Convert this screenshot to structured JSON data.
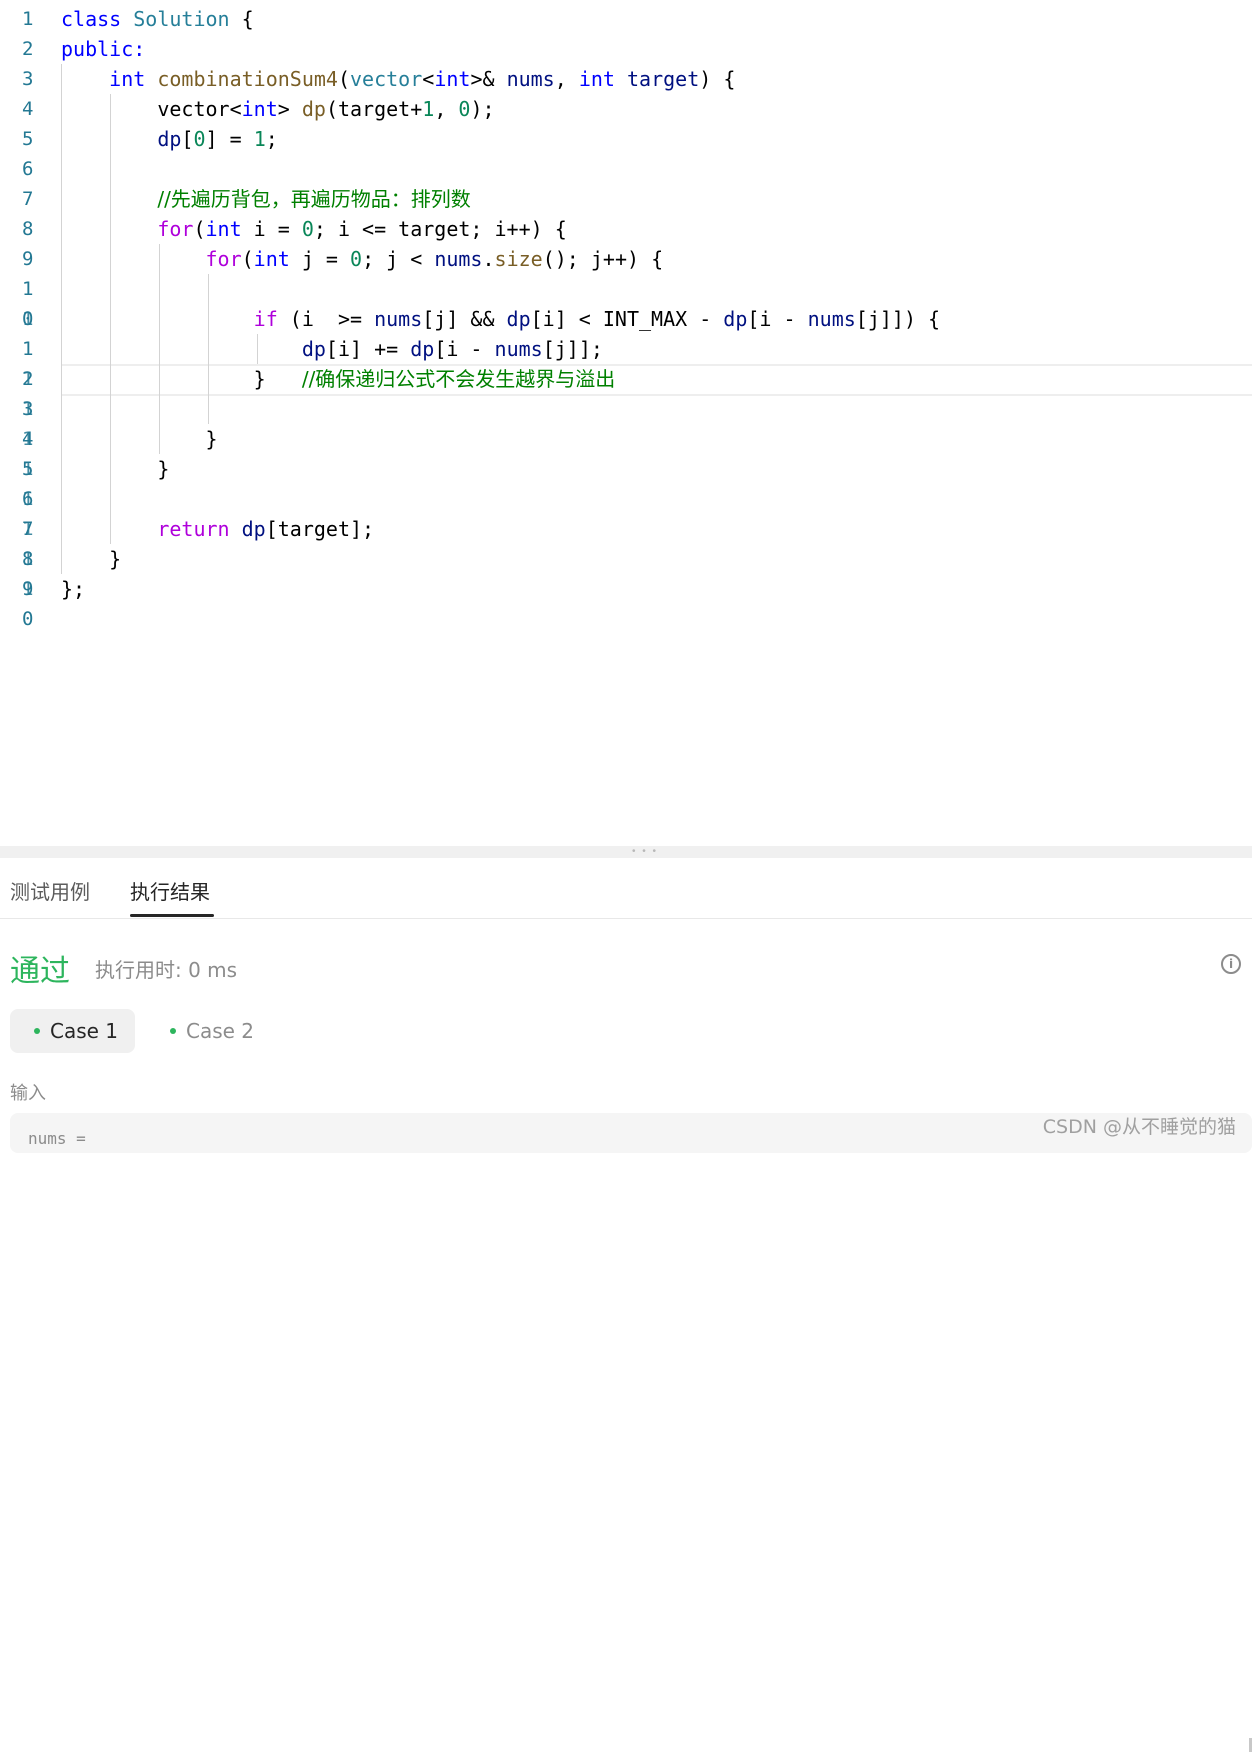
{
  "editor": {
    "line_numbers": [
      "1",
      "2",
      "3",
      "4",
      "5",
      "6",
      "7",
      "8",
      "9",
      "1",
      "0",
      "1",
      "2",
      "3",
      "4",
      "5",
      "6",
      "7",
      "8",
      "9",
      "0"
    ],
    "overlap_numbers": [
      "",
      "",
      "",
      "",
      "",
      "",
      "",
      "",
      "",
      "",
      "1",
      "",
      "1",
      "1",
      "1",
      "1",
      "1",
      "1",
      "1",
      "1",
      ""
    ],
    "lines": [
      [
        {
          "t": "class ",
          "c": "kw"
        },
        {
          "t": "Solution",
          "c": "ty"
        },
        {
          "t": " {",
          "c": ""
        }
      ],
      [
        {
          "t": "public:",
          "c": "kw"
        }
      ],
      [
        {
          "t": "    ",
          "c": ""
        },
        {
          "t": "int",
          "c": "kw"
        },
        {
          "t": " ",
          "c": ""
        },
        {
          "t": "combinationSum4",
          "c": "fn"
        },
        {
          "t": "(",
          "c": ""
        },
        {
          "t": "vector",
          "c": "ty"
        },
        {
          "t": "<",
          "c": ""
        },
        {
          "t": "int",
          "c": "kw"
        },
        {
          "t": ">& ",
          "c": ""
        },
        {
          "t": "nums",
          "c": "var"
        },
        {
          "t": ", ",
          "c": ""
        },
        {
          "t": "int",
          "c": "kw"
        },
        {
          "t": " ",
          "c": ""
        },
        {
          "t": "target",
          "c": "var"
        },
        {
          "t": ") {",
          "c": ""
        }
      ],
      [
        {
          "t": "        vector<",
          "c": ""
        },
        {
          "t": "int",
          "c": "kw"
        },
        {
          "t": "> ",
          "c": ""
        },
        {
          "t": "dp",
          "c": "fn"
        },
        {
          "t": "(target+",
          "c": ""
        },
        {
          "t": "1",
          "c": "nm"
        },
        {
          "t": ", ",
          "c": ""
        },
        {
          "t": "0",
          "c": "nm"
        },
        {
          "t": ");",
          "c": ""
        }
      ],
      [
        {
          "t": "        ",
          "c": ""
        },
        {
          "t": "dp",
          "c": "var"
        },
        {
          "t": "[",
          "c": ""
        },
        {
          "t": "0",
          "c": "nm"
        },
        {
          "t": "] = ",
          "c": ""
        },
        {
          "t": "1",
          "c": "nm"
        },
        {
          "t": ";",
          "c": ""
        }
      ],
      [],
      [
        {
          "t": "        ",
          "c": ""
        },
        {
          "t": "//先遍历背包，再遍历物品：排列数",
          "c": "cm"
        }
      ],
      [
        {
          "t": "        ",
          "c": ""
        },
        {
          "t": "for",
          "c": "kw2"
        },
        {
          "t": "(",
          "c": ""
        },
        {
          "t": "int",
          "c": "kw"
        },
        {
          "t": " i = ",
          "c": ""
        },
        {
          "t": "0",
          "c": "nm"
        },
        {
          "t": "; i <= target; i++) {",
          "c": ""
        }
      ],
      [
        {
          "t": "            ",
          "c": ""
        },
        {
          "t": "for",
          "c": "kw2"
        },
        {
          "t": "(",
          "c": ""
        },
        {
          "t": "int",
          "c": "kw"
        },
        {
          "t": " j = ",
          "c": ""
        },
        {
          "t": "0",
          "c": "nm"
        },
        {
          "t": "; j < ",
          "c": ""
        },
        {
          "t": "nums",
          "c": "var"
        },
        {
          "t": ".",
          "c": ""
        },
        {
          "t": "size",
          "c": "fn"
        },
        {
          "t": "(); j++) {",
          "c": ""
        }
      ],
      [],
      [
        {
          "t": "                ",
          "c": ""
        },
        {
          "t": "if",
          "c": "kw2"
        },
        {
          "t": " (i  >= ",
          "c": ""
        },
        {
          "t": "nums",
          "c": "var"
        },
        {
          "t": "[j] && ",
          "c": ""
        },
        {
          "t": "dp",
          "c": "var"
        },
        {
          "t": "[i] < INT_MAX - ",
          "c": ""
        },
        {
          "t": "dp",
          "c": "var"
        },
        {
          "t": "[i - ",
          "c": ""
        },
        {
          "t": "nums",
          "c": "var"
        },
        {
          "t": "[j]]) {",
          "c": ""
        }
      ],
      [
        {
          "t": "                    ",
          "c": ""
        },
        {
          "t": "dp",
          "c": "var"
        },
        {
          "t": "[i] += ",
          "c": ""
        },
        {
          "t": "dp",
          "c": "var"
        },
        {
          "t": "[i - ",
          "c": ""
        },
        {
          "t": "nums",
          "c": "var"
        },
        {
          "t": "[j]];",
          "c": ""
        }
      ],
      [
        {
          "t": "                }   ",
          "c": ""
        },
        {
          "t": "//确保递归公式不会发生越界与溢出",
          "c": "cm"
        }
      ],
      [],
      [
        {
          "t": "            }",
          "c": ""
        }
      ],
      [
        {
          "t": "        }",
          "c": ""
        }
      ],
      [],
      [
        {
          "t": "        ",
          "c": ""
        },
        {
          "t": "return",
          "c": "kw2"
        },
        {
          "t": " ",
          "c": ""
        },
        {
          "t": "dp",
          "c": "var"
        },
        {
          "t": "[target];",
          "c": ""
        }
      ],
      [
        {
          "t": "    }",
          "c": ""
        }
      ],
      [
        {
          "t": "};",
          "c": ""
        }
      ],
      []
    ]
  },
  "panel": {
    "tabs": [
      {
        "label": "测试用例",
        "active": false
      },
      {
        "label": "执行结果",
        "active": true
      }
    ],
    "status": "通过",
    "runtime": "执行用时: 0 ms",
    "cases": [
      "Case 1",
      "Case 2"
    ],
    "input_label": "输入",
    "input_first_line": "nums ="
  },
  "watermark": "CSDN @从不睡觉的猫",
  "icons": {
    "info": "info-icon",
    "resize": "drag-handle-icon"
  },
  "colors": {
    "pass": "#2db55d",
    "keyword": "#0000ff",
    "control": "#af00db",
    "comment": "#008000",
    "type": "#267f99",
    "function": "#795e26",
    "number": "#098658",
    "variable": "#001080",
    "line_number": "#237893"
  }
}
